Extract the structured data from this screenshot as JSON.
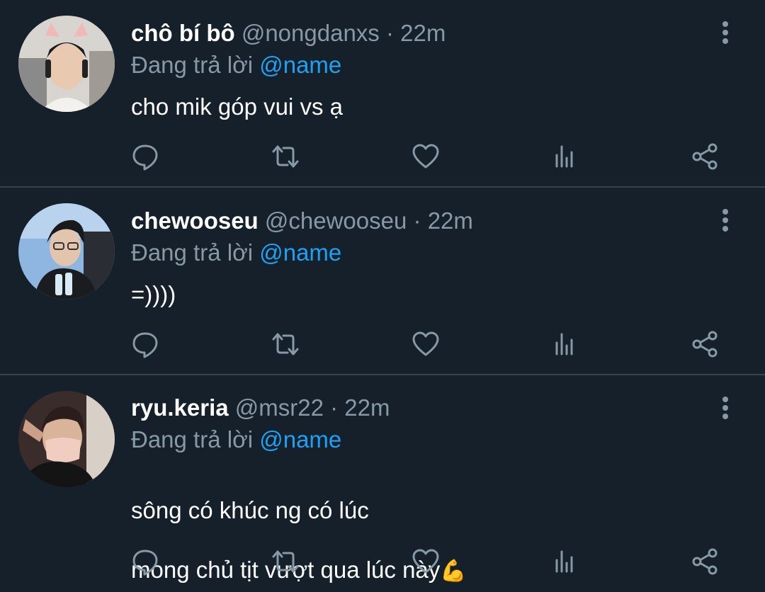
{
  "colors": {
    "background": "#15202b",
    "divider": "#38444d",
    "secondary_text": "#8899a6",
    "mention": "#1da1f2",
    "primary_text": "#ffffff"
  },
  "replies": [
    {
      "display_name": "chô bí bô",
      "handle": "@nongdanxs",
      "separator": "·",
      "time": "22m",
      "replying_to_label": "Đang trả lời",
      "replying_to_mention": "@name",
      "text": "cho mik góp vui vs ạ",
      "avatar": "avatar-photo"
    },
    {
      "display_name": "chewooseu",
      "handle": "@chewooseu",
      "separator": "·",
      "time": "22m",
      "replying_to_label": "Đang trả lời",
      "replying_to_mention": "@name",
      "text": "=))))",
      "avatar": "avatar-photo"
    },
    {
      "display_name": "ryu.keria",
      "handle": "@msr22",
      "separator": "·",
      "time": "22m",
      "replying_to_label": "Đang trả lời",
      "replying_to_mention": "@name",
      "text_line1": "sông có khúc ng có lúc",
      "text_line2": "mong chủ tịt vượt qua lúc này",
      "emoji": "💪",
      "avatar": "avatar-photo"
    }
  ],
  "icons": {
    "reply": "reply-icon",
    "retweet": "retweet-icon",
    "like": "heart-icon",
    "analytics": "analytics-icon",
    "share": "share-icon",
    "more": "more-vertical-icon"
  }
}
